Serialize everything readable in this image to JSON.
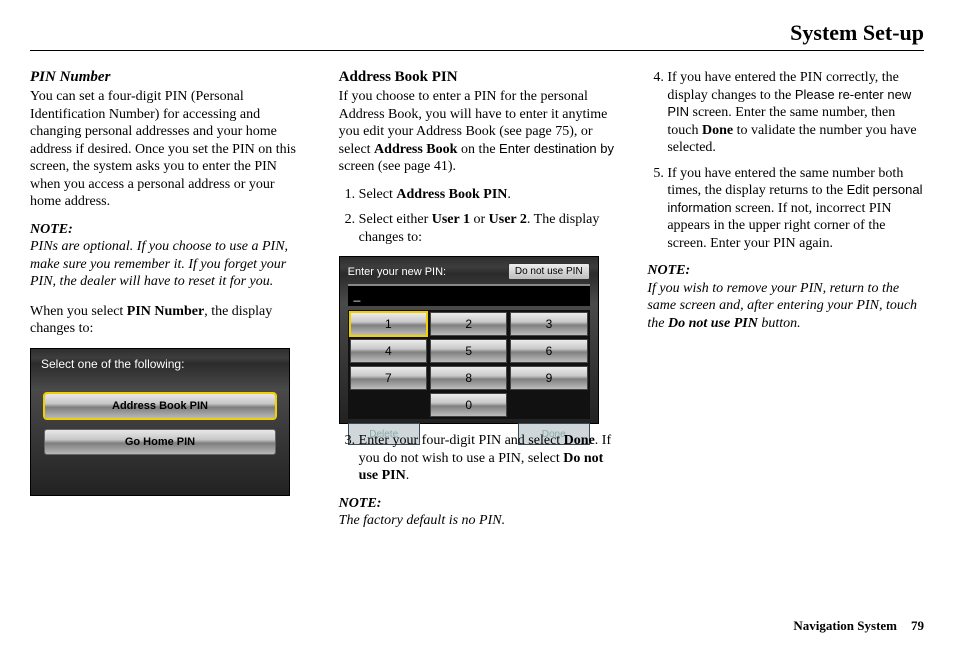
{
  "page_title": "System Set-up",
  "footer": {
    "label": "Navigation System",
    "page": "79"
  },
  "col1": {
    "heading": "PIN Number",
    "para1": "You can set a four-digit PIN (Personal Identification Number) for accessing and changing personal addresses and your home address if desired. Once you set the PIN on this screen, the system asks you to enter the PIN when you access a personal address or your home address.",
    "note_label": "NOTE:",
    "note_body": "PINs are optional. If you choose to use a PIN, make sure you remember it. If you forget your PIN, the dealer will have to reset it for you.",
    "para2_pre": "When you select ",
    "para2_bold": "PIN Number",
    "para2_post": ", the display changes to:",
    "screen1": {
      "prompt": "Select one of the following:",
      "btn1": "Address Book PIN",
      "btn2": "Go Home PIN"
    }
  },
  "col2": {
    "heading": "Address Book PIN",
    "para1_a": "If you choose to enter a PIN for the personal Address Book, you will have to enter it anytime you edit your Address Book (see page 75), or select ",
    "para1_b": "Address Book",
    "para1_c": " on the ",
    "para1_d": "Enter destination by",
    "para1_e": " screen (see page 41).",
    "li1_a": "Select ",
    "li1_b": "Address Book PIN",
    "li1_c": ".",
    "li2_a": "Select either ",
    "li2_b": "User 1",
    "li2_c": " or ",
    "li2_d": "User 2",
    "li2_e": ". The display changes to:",
    "screen2": {
      "prompt": "Enter your new PIN:",
      "nopin": "Do not use PIN",
      "entry": "_",
      "keys": [
        "1",
        "2",
        "3",
        "4",
        "5",
        "6",
        "7",
        "8",
        "9",
        "0"
      ],
      "delete": "Delete",
      "done": "Done"
    },
    "li3_a": "Enter your four-digit PIN and select ",
    "li3_b": "Done",
    "li3_c": ". If you do not wish to use a PIN, select ",
    "li3_d": "Do not use PIN",
    "li3_e": ".",
    "note_label": "NOTE:",
    "note_body": "The factory default is no PIN."
  },
  "col3": {
    "li4_a": "If you have entered the PIN correctly, the display changes to the ",
    "li4_b": "Please re-enter new PIN",
    "li4_c": " screen. Enter the same number, then touch ",
    "li4_d": "Done",
    "li4_e": " to validate the number you have selected.",
    "li5_a": "If you have entered the same number both times, the display returns to the ",
    "li5_b": "Edit personal information",
    "li5_c": " screen. If not, incorrect PIN appears in the upper right corner of the screen. Enter your PIN again.",
    "note_label": "NOTE:",
    "note_a": "If you wish to remove your PIN, return to the same screen and, after entering your PIN, touch the ",
    "note_b": "Do not use PIN",
    "note_c": " button."
  }
}
